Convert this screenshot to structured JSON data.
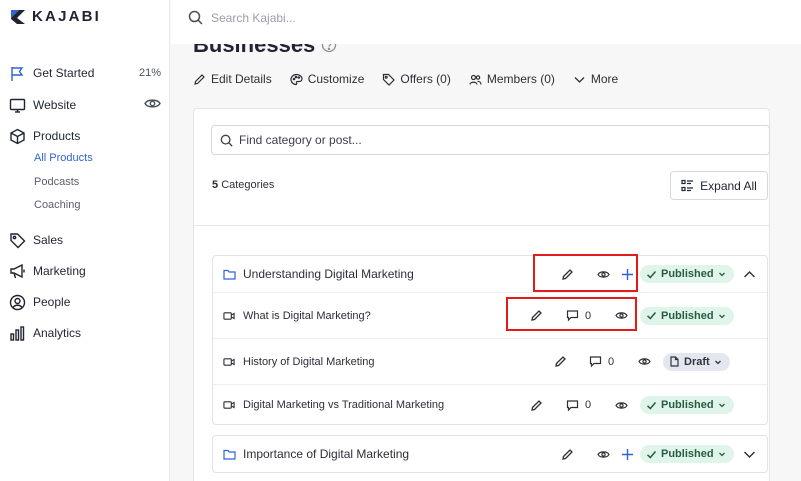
{
  "app": {
    "logo_text": "KAJABI"
  },
  "search": {
    "placeholder": "Search Kajabi..."
  },
  "sidebar": {
    "items": [
      {
        "label": "Get Started",
        "right": "21%"
      },
      {
        "label": "Website"
      },
      {
        "label": "Products"
      },
      {
        "label": "Sales"
      },
      {
        "label": "Marketing"
      },
      {
        "label": "People"
      },
      {
        "label": "Analytics"
      }
    ],
    "sub_items": [
      "All Products",
      "Podcasts",
      "Coaching"
    ]
  },
  "page": {
    "title": "Businesses",
    "tabs": [
      "Edit Details",
      "Customize",
      "Offers (0)",
      "Members (0)",
      "More"
    ]
  },
  "panel": {
    "filter_placeholder": "Find category or post...",
    "category_count": "5",
    "category_label": "Categories",
    "expand_label": "Expand All"
  },
  "categories": [
    {
      "title": "Understanding Digital Marketing",
      "status": "Published",
      "posts": [
        {
          "title": "What is Digital Marketing?",
          "comments": "0",
          "status": "Published"
        },
        {
          "title": "History of Digital Marketing",
          "comments": "0",
          "status": "Draft"
        },
        {
          "title": "Digital Marketing vs Traditional Marketing",
          "comments": "0",
          "status": "Published"
        }
      ]
    },
    {
      "title": "Importance of Digital Marketing",
      "status": "Published"
    }
  ],
  "colors": {
    "accent": "#2e63d9",
    "published_bg": "#dff5ea",
    "draft_bg": "#e4e7ee",
    "highlight": "#e21b1b"
  }
}
